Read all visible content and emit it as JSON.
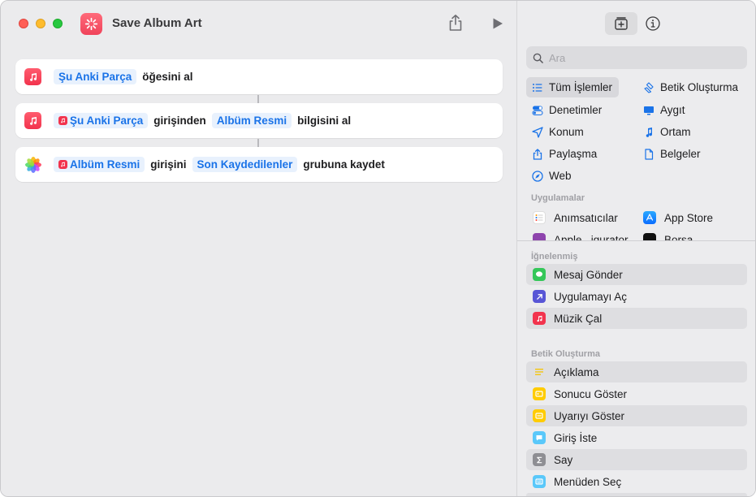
{
  "window": {
    "title": "Save Album Art"
  },
  "workflow": {
    "actions": [
      {
        "icon": "music-icon",
        "parts": [
          {
            "type": "token",
            "text": "Şu Anki Parça"
          },
          {
            "type": "text",
            "text": "öğesini al"
          }
        ]
      },
      {
        "icon": "music-icon",
        "parts": [
          {
            "type": "token",
            "text": "Şu Anki Parça"
          },
          {
            "type": "text",
            "text": "girişinden"
          },
          {
            "type": "token",
            "text": "Albüm Resmi"
          },
          {
            "type": "text",
            "text": "bilgisini al"
          }
        ]
      },
      {
        "icon": "photos-icon",
        "parts": [
          {
            "type": "token",
            "text": "Albüm Resmi"
          },
          {
            "type": "text",
            "text": "girişini"
          },
          {
            "type": "token",
            "text": "Son Kaydedilenler"
          },
          {
            "type": "text",
            "text": "grubuna kaydet"
          }
        ]
      }
    ]
  },
  "sidebar": {
    "search_placeholder": "Ara",
    "categories_left": [
      "Tüm İşlemler",
      "Denetimler",
      "Konum",
      "Paylaşma",
      "Web"
    ],
    "categories_right": [
      "Betik Oluşturma",
      "Aygıt",
      "Ortam",
      "Belgeler"
    ],
    "apps_header": "Uygulamalar",
    "apps": [
      "Anımsatıcılar",
      "App Store",
      "Apple...igurator",
      "Borsa"
    ],
    "pinned_header": "İğnelenmiş",
    "pinned": [
      "Mesaj Gönder",
      "Uygulamayı Aç",
      "Müzik Çal"
    ],
    "scripting_header": "Betik Oluşturma",
    "scripting": [
      "Açıklama",
      "Sonucu Göster",
      "Uyarıyı Göster",
      "Giriş İste",
      "Say",
      "Menüden Seç"
    ]
  },
  "colors": {
    "accent": "#1a73e8",
    "token_bg": "#e8f1fd",
    "music": "#f2334d"
  }
}
